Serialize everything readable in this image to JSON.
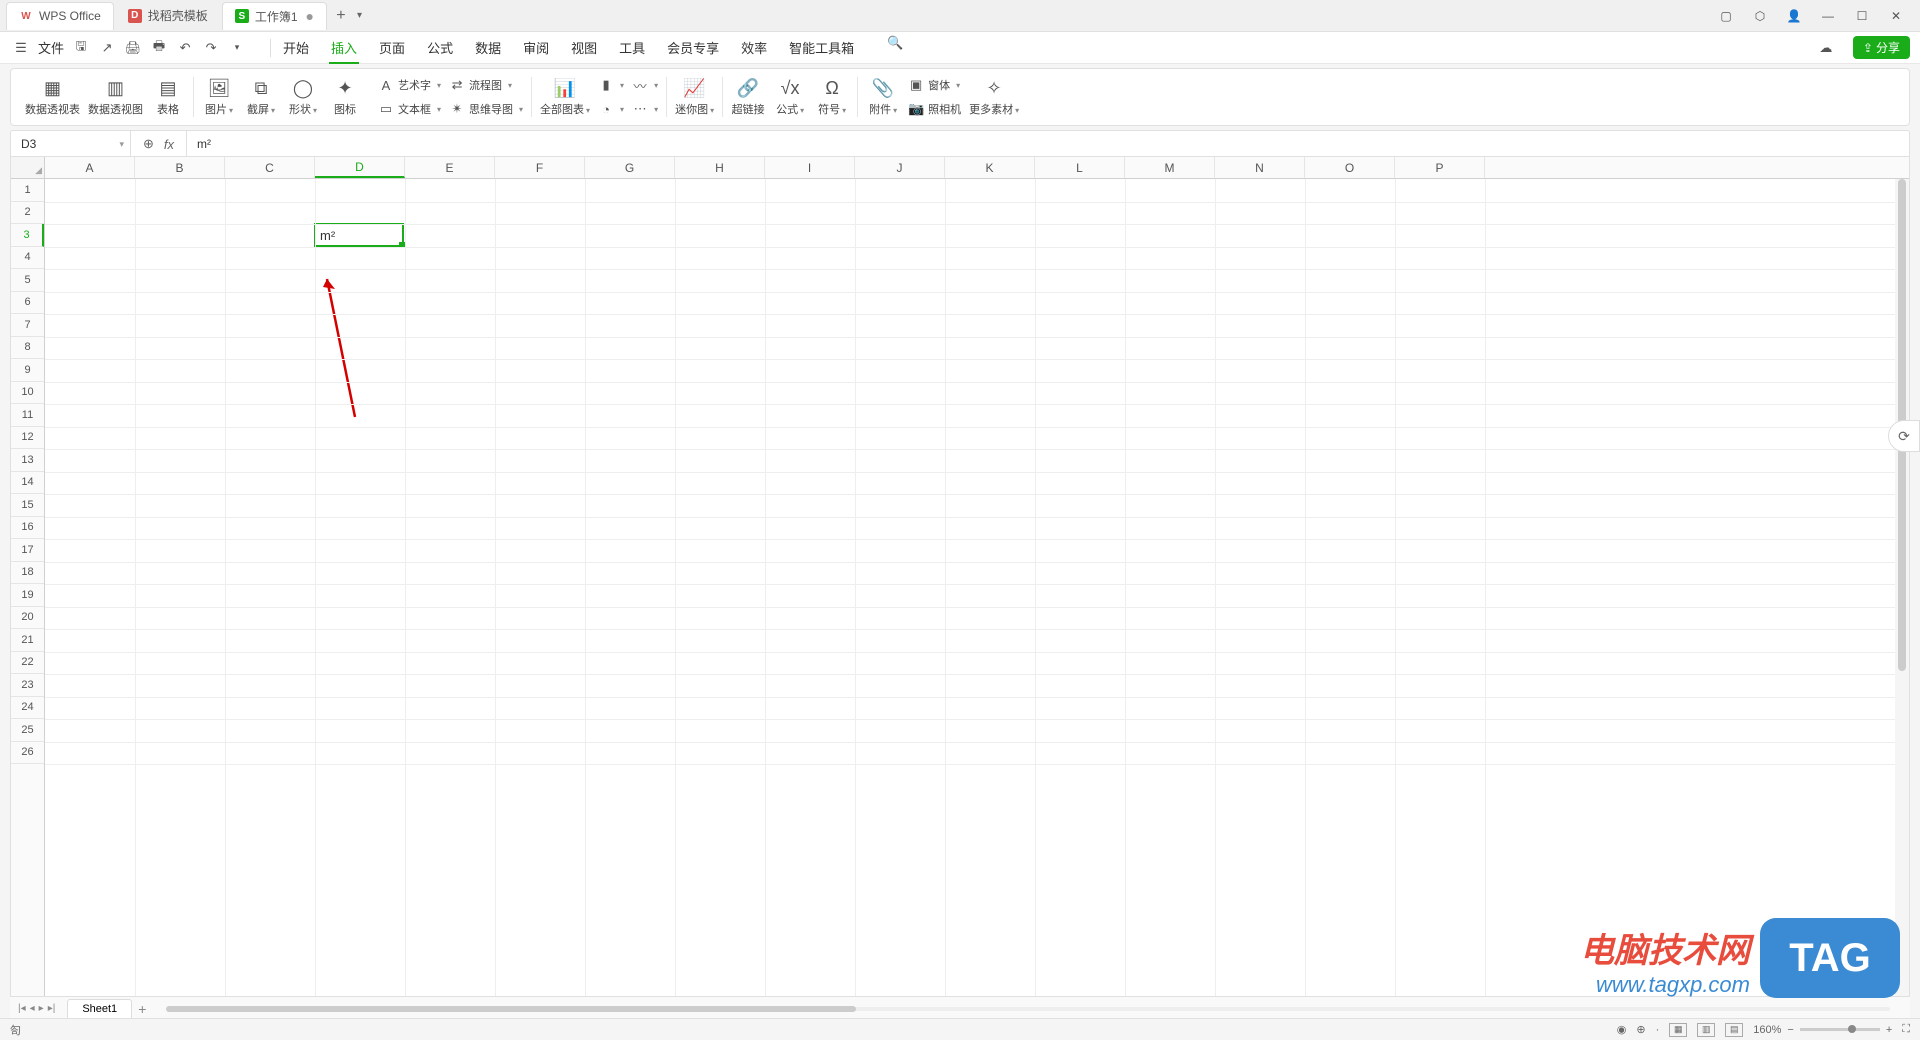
{
  "titlebar": {
    "tabs": [
      {
        "icon": "W",
        "iconClass": "wps",
        "label": "WPS Office"
      },
      {
        "icon": "D",
        "iconClass": "doc",
        "label": "找稻壳模板"
      },
      {
        "icon": "S",
        "iconClass": "sheet",
        "label": "工作簿1",
        "active": true,
        "closeable": true
      }
    ]
  },
  "menubar": {
    "file_label": "文件",
    "tabs": [
      "开始",
      "插入",
      "页面",
      "公式",
      "数据",
      "审阅",
      "视图",
      "工具",
      "会员专享",
      "效率",
      "智能工具箱"
    ],
    "active_tab_index": 1,
    "share_label": "分享"
  },
  "ribbon": {
    "g1": {
      "pivot_table": "数据透视表",
      "pivot_chart": "数据透视图",
      "table": "表格"
    },
    "g2": {
      "picture": "图片",
      "screenshot": "截屏",
      "shape": "形状",
      "icon": "图标"
    },
    "g3": {
      "wordart": "艺术字",
      "textbox": "文本框",
      "flowchart": "流程图",
      "mindmap": "思维导图"
    },
    "g4": {
      "all_charts": "全部图表",
      "col_chart": "柱",
      "line_chart": "折"
    },
    "g5": {
      "sparkline": "迷你图"
    },
    "g6": {
      "hyperlink": "超链接",
      "equation": "公式",
      "symbol": "符号"
    },
    "g7": {
      "attach": "附件",
      "camera": "照相机",
      "object": "窗体",
      "more": "更多素材"
    }
  },
  "formulabar": {
    "namebox": "D3",
    "fx_value": "m²"
  },
  "grid": {
    "columns": [
      "A",
      "B",
      "C",
      "D",
      "E",
      "F",
      "G",
      "H",
      "I",
      "J",
      "K",
      "L",
      "M",
      "N",
      "O",
      "P"
    ],
    "row_count": 26,
    "selected_col_index": 3,
    "selected_row": 3,
    "cell_value": "m²"
  },
  "sheetbar": {
    "sheet_name": "Sheet1"
  },
  "statusbar": {
    "indicator": "匌",
    "zoom": "160%"
  },
  "watermark": {
    "text": "电脑技术网",
    "url": "www.tagxp.com",
    "tag": "TAG"
  }
}
